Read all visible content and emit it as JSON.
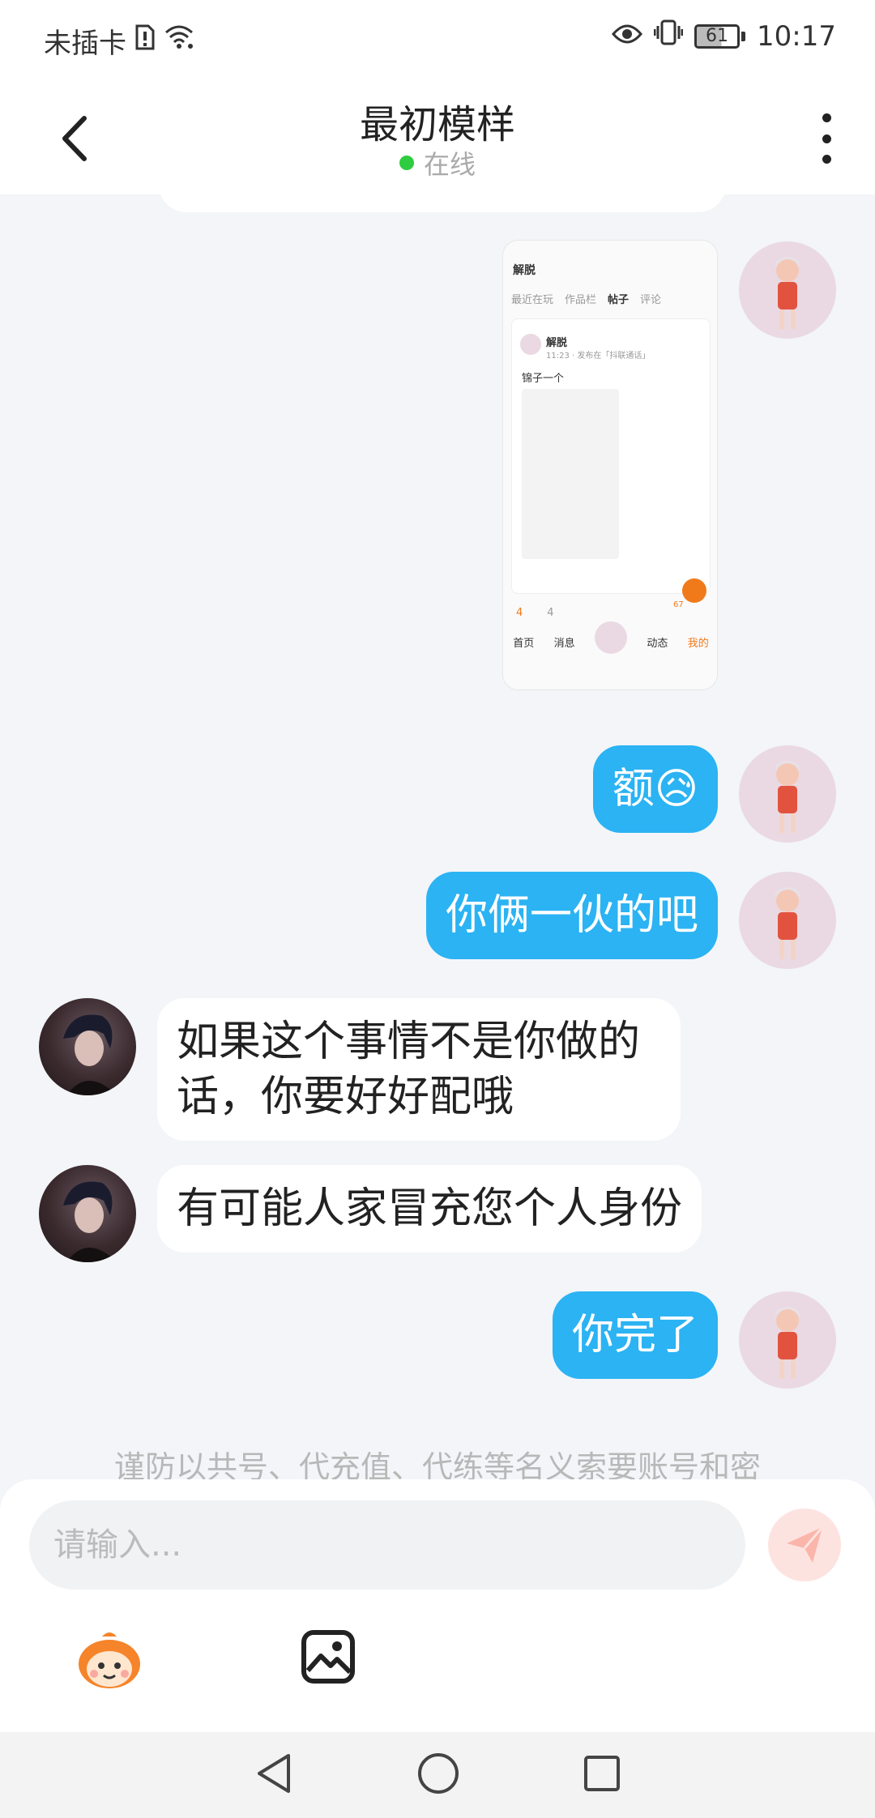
{
  "status_bar": {
    "carrier": "未插卡",
    "battery": "61",
    "time": "10:17"
  },
  "header": {
    "title": "最初模样",
    "status": "在线"
  },
  "screenshot_message": {
    "username": "解脱",
    "tabs": [
      "最近在玩",
      "作品栏",
      "帖子",
      "评论"
    ],
    "post_author": "解脱",
    "post_meta": "11:23 · 发布在「抖联通话」",
    "post_text": "锦子一个",
    "likes": "4",
    "comments": "4",
    "fav_count": "67",
    "nav": [
      "首页",
      "消息",
      "",
      "动态",
      "我的"
    ]
  },
  "messages": [
    {
      "side": "me",
      "text": "额😥"
    },
    {
      "side": "me",
      "text": "你俩一伙的吧"
    },
    {
      "side": "other",
      "text": "如果这个事情不是你做的话，你要好好配哦"
    },
    {
      "side": "other",
      "text": "有可能人家冒充您个人身份"
    },
    {
      "side": "me",
      "text": "你完了"
    }
  ],
  "disclaimer": "谨防以共号、代充值、代练等名义索要账号和密",
  "input": {
    "placeholder": "请输入..."
  },
  "colors": {
    "my_bubble": "#2bb3f3",
    "other_bubble": "#ffffff",
    "online_dot": "#2ecc40",
    "send_button": "#fde3e0"
  }
}
